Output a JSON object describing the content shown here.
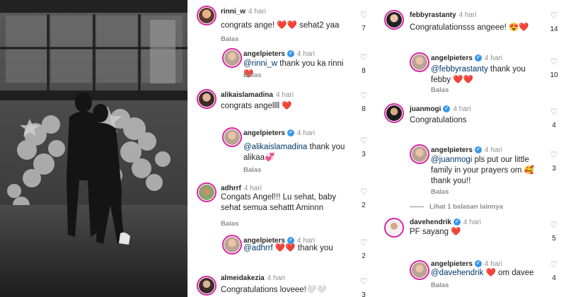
{
  "photo": {
    "alt": ""
  },
  "ui": {
    "reply_label": "Balas",
    "heart_icon": "heart-outline-icon",
    "verified_icon": "verified-badge-icon"
  },
  "left_column": [
    {
      "username": "rinni_w",
      "time": "4 hari",
      "text": "congrats ange! ❤️❤️ sehat2 yaa",
      "likes": "7",
      "reply": false
    },
    {
      "username": "angelpieters",
      "time": "4 hari",
      "mention": "@rinni_w",
      "text": " thank you ka rinni❤️",
      "likes": "8",
      "reply": true
    },
    {
      "username": "alikaislamadina",
      "time": "4 hari",
      "text": "congrats angellll ❤️",
      "likes": "8",
      "reply": false
    },
    {
      "username": "angelpieters",
      "time": "4 hari",
      "mention": "@alikaislamadina",
      "text": " thank you alikaa💞",
      "likes": "3",
      "reply": true
    },
    {
      "username": "adhrrf",
      "time": "4 hari",
      "text": "Congats Angel!!! Lu sehat, baby sehat semua sehattt Aminnn",
      "likes": "2",
      "reply": false
    },
    {
      "username": "angelpieters",
      "time": "4 hari",
      "mention": "@adhrrf",
      "text": " ❤️❤️ thank you",
      "likes": "2",
      "reply": true
    },
    {
      "username": "almeidakezia",
      "time": "4 hari",
      "text": "Congratulations loveee!🤍🤍",
      "likes": "3",
      "reply": false
    }
  ],
  "right_column": [
    {
      "username": "febbyrastanty",
      "time": "4 hari",
      "text": "Congratulationsss angeee! 😍❤️",
      "likes": "14",
      "reply": false
    },
    {
      "username": "angelpieters",
      "time": "4 hari",
      "mention": "@febbyrastanty",
      "text": " thank you febby ❤️❤️",
      "likes": "10",
      "reply": true
    },
    {
      "username": "juanmogi",
      "time": "4 hari",
      "text": "Congratulations",
      "likes": "4",
      "reply": false
    },
    {
      "username": "angelpieters",
      "time": "4 hari",
      "mention": "@juanmogi",
      "text": " pls put our little family in your prayers om 🥰 thank you!!",
      "likes": "3",
      "reply": true
    },
    {
      "username": "davehendrik",
      "time": "4 hari",
      "text": "PF sayang ❤️",
      "likes": "5",
      "reply": false
    },
    {
      "username": "angelpieters",
      "time": "4 hari",
      "mention": "@davehendrik",
      "text": " ❤️ om davee",
      "likes": "4",
      "reply": true
    }
  ],
  "more_replies_label": "Lihat 1 balasan lainnya",
  "colors": {
    "verified": "#3897f0",
    "ring": "#d6249f",
    "mention": "#00376b",
    "muted": "#8e8e8e"
  }
}
